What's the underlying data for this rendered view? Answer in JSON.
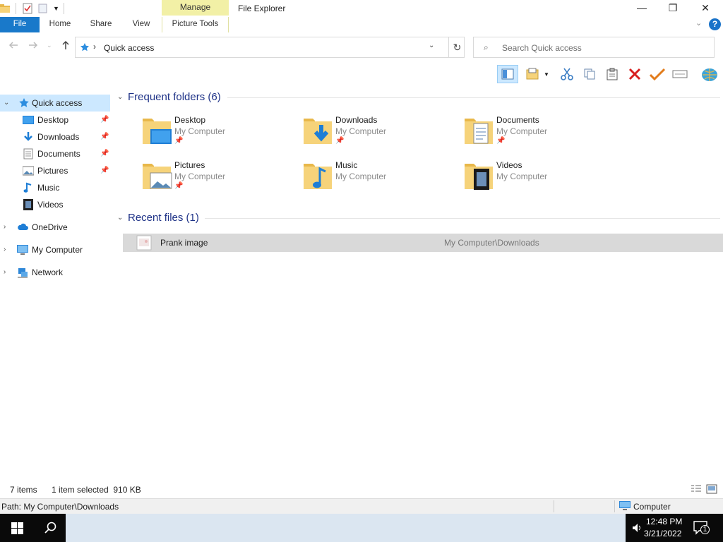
{
  "window": {
    "title": "File Explorer",
    "manage_label": "Manage"
  },
  "controls": {
    "minimize": "—",
    "maximize": "❐",
    "close": "✕"
  },
  "ribbon": {
    "tabs": {
      "file": "File",
      "home": "Home",
      "share": "Share",
      "view": "View",
      "picture_tools": "Picture Tools"
    },
    "help": "?",
    "expand": "⌄"
  },
  "address": {
    "path": "Quick access",
    "sep": "›",
    "drop": "⌄",
    "refresh": "↻"
  },
  "search": {
    "placeholder": "Search Quick access"
  },
  "nav": {
    "quick_access": "Quick access",
    "items": [
      {
        "label": "Desktop"
      },
      {
        "label": "Downloads"
      },
      {
        "label": "Documents"
      },
      {
        "label": "Pictures"
      },
      {
        "label": "Music"
      },
      {
        "label": "Videos"
      }
    ],
    "onedrive": "OneDrive",
    "my_computer": "My Computer",
    "network": "Network",
    "chev_open": "⌄",
    "chev_closed": "›",
    "pin": "📌"
  },
  "frequent": {
    "title": "Frequent folders (6)",
    "folders": [
      {
        "name": "Desktop",
        "location": "My Computer",
        "pinned": "📌"
      },
      {
        "name": "Downloads",
        "location": "My Computer",
        "pinned": "📌"
      },
      {
        "name": "Documents",
        "location": "My Computer",
        "pinned": "📌"
      },
      {
        "name": "Pictures",
        "location": "My Computer",
        "pinned": "📌"
      },
      {
        "name": "Music",
        "location": "My Computer"
      },
      {
        "name": "Videos",
        "location": "My Computer"
      }
    ]
  },
  "recent": {
    "title": "Recent files (1)",
    "files": [
      {
        "name": "Prank image",
        "path": "My Computer\\Downloads"
      }
    ]
  },
  "status": {
    "items": "7 items",
    "selected": "1 item selected  910 KB"
  },
  "pathbar": {
    "path": "Path: My Computer\\Downloads",
    "computer": "Computer"
  },
  "taskbar": {
    "time": "12:48 PM",
    "date": "3/21/2022",
    "notifications": "1"
  },
  "colors": {
    "accent": "#1979ca",
    "selection": "#cce8ff",
    "folder": "#f6d37a",
    "manage": "#f2f0a6"
  }
}
